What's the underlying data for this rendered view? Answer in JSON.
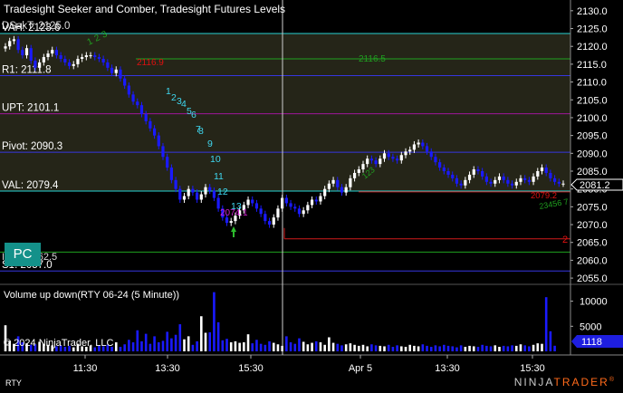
{
  "window": {
    "indicator_title": "Tradesight Seeker and Comber, Tradesight Futures Levels",
    "volume_title": "Volume up down(RTY 06-24 (5 Minute))",
    "copyright": "© 2024 NinjaTrader, LLC",
    "symbol": "RTY",
    "pc_button": "PC",
    "logo_left": "NINJA",
    "logo_right": "TRADER"
  },
  "colors": {
    "background": "#000000",
    "plot_bg": "#252518",
    "up_bar": "#ffffff",
    "down_bar": "#1a1aff",
    "vah_line": "#27d3d3",
    "r1_line": "#3636e0",
    "upt_line": "#a0179a",
    "pivot_line": "#3636e0",
    "val_line": "#27d3d3",
    "s1_line": "#3636e0",
    "green_line": "#1fa21f",
    "red_line": "#d21b1b",
    "setup_cyan": "#3fd7f0",
    "setup_green": "#20a020",
    "setup_red": "#e01010",
    "magenta": "#d020d0",
    "arrow_green": "#2dbb2d",
    "current_price_bg": "#1e1ee0"
  },
  "levels": [
    {
      "name": "vah",
      "label": "VAH: 2123.6",
      "price": 2123.6,
      "color": "#27d3d3"
    },
    {
      "name": "r1",
      "label": "R1: 2111.8",
      "price": 2111.8,
      "color": "#3636e0"
    },
    {
      "name": "upt",
      "label": "UPT: 2101.1",
      "price": 2101.1,
      "color": "#a0179a"
    },
    {
      "name": "pivot",
      "label": "Pivot: 2090.3",
      "price": 2090.3,
      "color": "#3636e0"
    },
    {
      "name": "val",
      "label": "VAL: 2079.4",
      "price": 2079.4,
      "color": "#27d3d3"
    },
    {
      "name": "s1",
      "label": "S1: 2057.0",
      "price": 2057.0,
      "color": "#3636e0"
    }
  ],
  "overlap_texts": {
    "top_left": "DSakT: 2125.0",
    "mid_left": "IIIIIIII 2062.5"
  },
  "green_lines": [
    {
      "price": 2116.5,
      "label": "2116.5",
      "from": "13:00",
      "to": "end"
    },
    {
      "price": 2062.3,
      "label": "",
      "from": "start",
      "to": "end"
    }
  ],
  "red_lines": [
    {
      "price": 2079.2,
      "label": "2079.2",
      "from": "Apr 5 09:30",
      "to": "end"
    },
    {
      "price": 2066.0,
      "label": "2",
      "from": "16:15",
      "to": "end"
    }
  ],
  "price_axis": {
    "ticks": [
      "2130.0",
      "2125.0",
      "2120.0",
      "2115.0",
      "2110.0",
      "2105.0",
      "2100.0",
      "2095.0",
      "2090.0",
      "2085.0",
      "2080.0",
      "2075.0",
      "2070.0",
      "2065.0",
      "2060.0",
      "2055.0"
    ],
    "min": 2053.5,
    "max": 2132.5,
    "current_price": "2081.2"
  },
  "volume_axis": {
    "ticks": [
      "10000",
      "5000"
    ],
    "max": 13000,
    "current_volume": "1118"
  },
  "time_axis": {
    "labels": [
      "11:30",
      "13:30",
      "15:30",
      "Apr 5",
      "13:30",
      "15:30"
    ]
  },
  "signals": {
    "seeker_down_count": [
      "1",
      "2",
      "3",
      "4",
      "5",
      "6",
      "7",
      "8",
      "9",
      "10",
      "11",
      "12",
      "13"
    ],
    "green_count": [
      "1",
      "2",
      "3"
    ],
    "magenta_label": "2074.1",
    "red_top_label": "2116.9",
    "green_right_count": "23456 7"
  },
  "chart_data": {
    "type": "candlestick",
    "interval": "5 Minute",
    "instrument": "RTY 06-24",
    "y_range": [
      2053.5,
      2132.5
    ],
    "closes": [
      2120,
      2121.5,
      2122,
      2119,
      2117.5,
      2119.5,
      2116,
      2114,
      2115.5,
      2117,
      2118,
      2119,
      2117.5,
      2116.5,
      2115.5,
      2114.5,
      2115,
      2116.5,
      2117,
      2117.5,
      2117.5,
      2117,
      2116.5,
      2115.5,
      2114,
      2112.5,
      2113.5,
      2111,
      2109,
      2106.5,
      2104.5,
      2103.5,
      2101,
      2099,
      2097,
      2095,
      2092,
      2089,
      2086,
      2082.5,
      2080,
      2077,
      2078,
      2080,
      2079,
      2077,
      2078.5,
      2080.5,
      2079.5,
      2077.5,
      2074.5,
      2072,
      2070.5,
      2071,
      2072.5,
      2074,
      2075.5,
      2077,
      2076,
      2074.5,
      2073,
      2071,
      2070,
      2072,
      2074.5,
      2077.5,
      2076,
      2075,
      2074.5,
      2073,
      2074,
      2075.5,
      2077,
      2076.5,
      2078,
      2080,
      2081.5,
      2082.5,
      2080.5,
      2079,
      2080.5,
      2083,
      2084.5,
      2085.5,
      2087,
      2088.5,
      2088,
      2087,
      2088.5,
      2090,
      2089,
      2088.5,
      2088,
      2089.5,
      2090.5,
      2091,
      2092.5,
      2093,
      2092,
      2090.5,
      2089,
      2087.5,
      2086,
      2085,
      2084,
      2083,
      2081.5,
      2081,
      2082.5,
      2084,
      2085.5,
      2085,
      2083.5,
      2082,
      2081.5,
      2082.5,
      2083.5,
      2082.5,
      2081.5,
      2081,
      2082,
      2083,
      2082.5,
      2082,
      2083.5,
      2085,
      2086,
      2084.5,
      2083,
      2082,
      2081.5,
      2081.5
    ],
    "volumes": [
      5200,
      2100,
      1500,
      3000,
      1800,
      1600,
      1300,
      1400,
      1900,
      1500,
      1300,
      1200,
      1000,
      1200,
      900,
      1100,
      800,
      1500,
      1000,
      900,
      1200,
      800,
      1100,
      1000,
      1300,
      900,
      1800,
      900,
      1400,
      2300,
      1800,
      4200,
      2000,
      3500,
      1500,
      3000,
      1800,
      2100,
      3900,
      2600,
      3300,
      5400,
      2400,
      3000,
      1300,
      2000,
      7000,
      3700,
      3800,
      11800,
      5800,
      2200,
      2500,
      1800,
      2000,
      1700,
      1800,
      3400,
      1600,
      2300,
      1500,
      1300,
      2000,
      1700,
      1400,
      1100,
      3000,
      1800,
      1500,
      2600,
      1900,
      1400,
      1700,
      2000,
      1800,
      1300,
      2800,
      1700,
      1500,
      1200,
      1400,
      1600,
      1300,
      1100,
      1300,
      1000,
      1400,
      1200,
      1100,
      1000,
      1300,
      900,
      1200,
      1000,
      900,
      1300,
      1100,
      1000,
      1400,
      1100,
      900,
      1200,
      1000,
      1300,
      1100,
      1000,
      800,
      1200,
      900,
      1100,
      1000,
      900,
      1300,
      1100,
      1000,
      1200,
      900,
      1100,
      1000,
      1200,
      1100,
      1400,
      1200,
      1000,
      1300,
      1600,
      1500,
      10800,
      4000,
      1118
    ]
  }
}
